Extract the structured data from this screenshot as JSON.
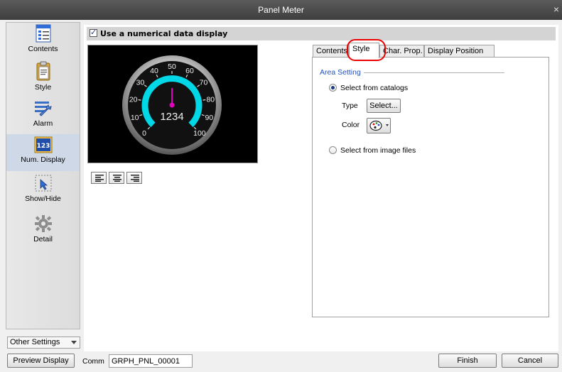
{
  "window": {
    "title": "Panel Meter",
    "close_glyph": "×"
  },
  "sidebar": {
    "items": [
      {
        "label": "Contents",
        "icon": "contents-icon"
      },
      {
        "label": "Style",
        "icon": "style-icon"
      },
      {
        "label": "Alarm",
        "icon": "alarm-icon"
      },
      {
        "label": "Num. Display",
        "icon": "num-display-icon",
        "active": true
      },
      {
        "label": "Show/Hide",
        "icon": "show-hide-icon"
      },
      {
        "label": "Detail",
        "icon": "detail-icon"
      }
    ],
    "other_settings": "Other Settings",
    "num_icon_text": "123"
  },
  "header": {
    "checkbox_label": "Use a numerical data display",
    "checked": true
  },
  "preview": {
    "ticks": [
      "0",
      "10",
      "20",
      "30",
      "40",
      "50",
      "60",
      "70",
      "80",
      "90",
      "100"
    ],
    "value_text": "1234",
    "colors": {
      "arc": "#00d8e8",
      "needle": "#e000c0",
      "background": "#000000"
    }
  },
  "tabs": [
    {
      "label": "Contents"
    },
    {
      "label": "Style",
      "active": true
    },
    {
      "label": "Char. Prop."
    },
    {
      "label": "Display Position"
    }
  ],
  "area_setting": {
    "title": "Area Setting",
    "option_catalogs": "Select from catalogs",
    "type_label": "Type",
    "select_button": "Select...",
    "color_label": "Color",
    "option_image_files": "Select from image files",
    "selected": "catalogs"
  },
  "footer": {
    "preview_button": "Preview Display",
    "comm_label": "Comm",
    "comm_value": "GRPH_PNL_00001",
    "finish_button": "Finish",
    "cancel_button": "Cancel"
  }
}
